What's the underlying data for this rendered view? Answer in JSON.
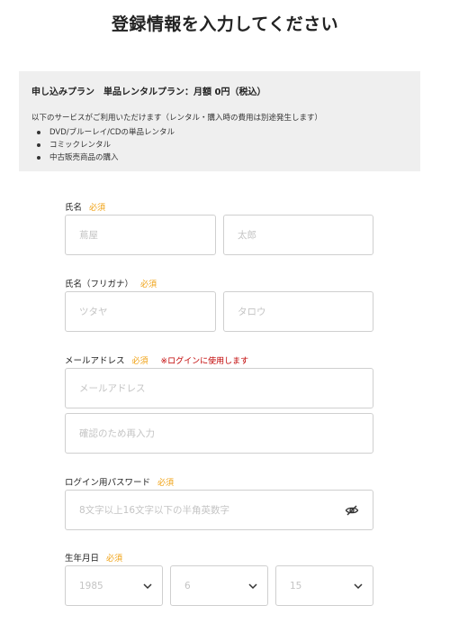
{
  "page_title": "登録情報を入力してください",
  "plan": {
    "title": "申し込みプラン　単品レンタルプラン：月額 0円（税込）",
    "note": "以下のサービスがご利用いただけます（レンタル・購入時の費用は別途発生します）",
    "items": [
      "DVD/ブルーレイ/CDの単品レンタル",
      "コミックレンタル",
      "中古販売商品の購入"
    ]
  },
  "required_label": "必須",
  "name": {
    "label": "氏名",
    "last_placeholder": "蔦屋",
    "first_placeholder": "太郎"
  },
  "kana": {
    "label": "氏名（フリガナ）",
    "last_placeholder": "ツタヤ",
    "first_placeholder": "タロウ"
  },
  "email": {
    "label": "メールアドレス",
    "note": "※ログインに使用します",
    "placeholder": "メールアドレス",
    "confirm_placeholder": "確認のため再入力"
  },
  "password": {
    "label": "ログイン用パスワード",
    "placeholder": "8文字以上16文字以下の半角英数字",
    "toggle_icon": "eye-slash-icon"
  },
  "birthday": {
    "label": "生年月日",
    "year": "1985",
    "month": "6",
    "day": "15"
  },
  "colors": {
    "required": "#f0a010",
    "warning": "#c00000",
    "plan_bg": "#efefef"
  }
}
